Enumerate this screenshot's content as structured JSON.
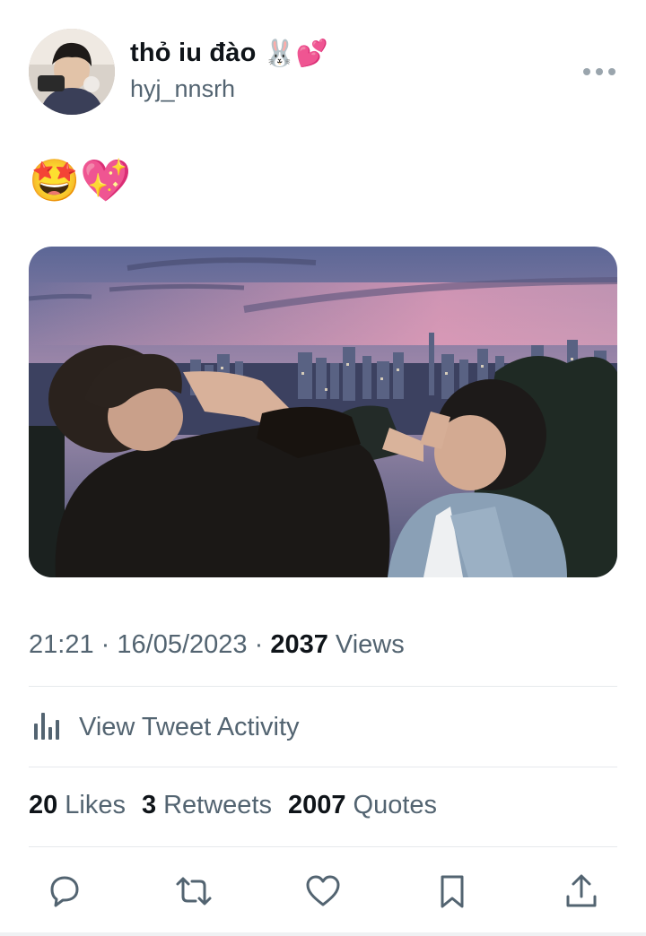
{
  "user": {
    "display_name": "thỏ iu đào",
    "name_emojis": "🐰💕",
    "handle": "hyj_nnsrh"
  },
  "tweet": {
    "text_emojis": "🤩💖"
  },
  "meta": {
    "time": "21:21",
    "date": "16/05/2023",
    "views_count": "2037",
    "views_label": "Views",
    "sep1": "·",
    "sep2": "·"
  },
  "activity": {
    "label": "View Tweet Activity"
  },
  "stats": {
    "likes_count": "20",
    "likes_label": "Likes",
    "retweets_count": "3",
    "retweets_label": "Retweets",
    "quotes_count": "2007",
    "quotes_label": "Quotes"
  },
  "icons": {
    "more": "more-icon",
    "activity": "bar-chart-icon",
    "reply": "reply-icon",
    "retweet": "retweet-icon",
    "like": "heart-icon",
    "bookmark": "bookmark-icon",
    "share": "share-icon"
  },
  "colors": {
    "text_primary": "#0f1419",
    "text_secondary": "#536471",
    "divider": "#e6e9ec",
    "icon": "#536471"
  }
}
